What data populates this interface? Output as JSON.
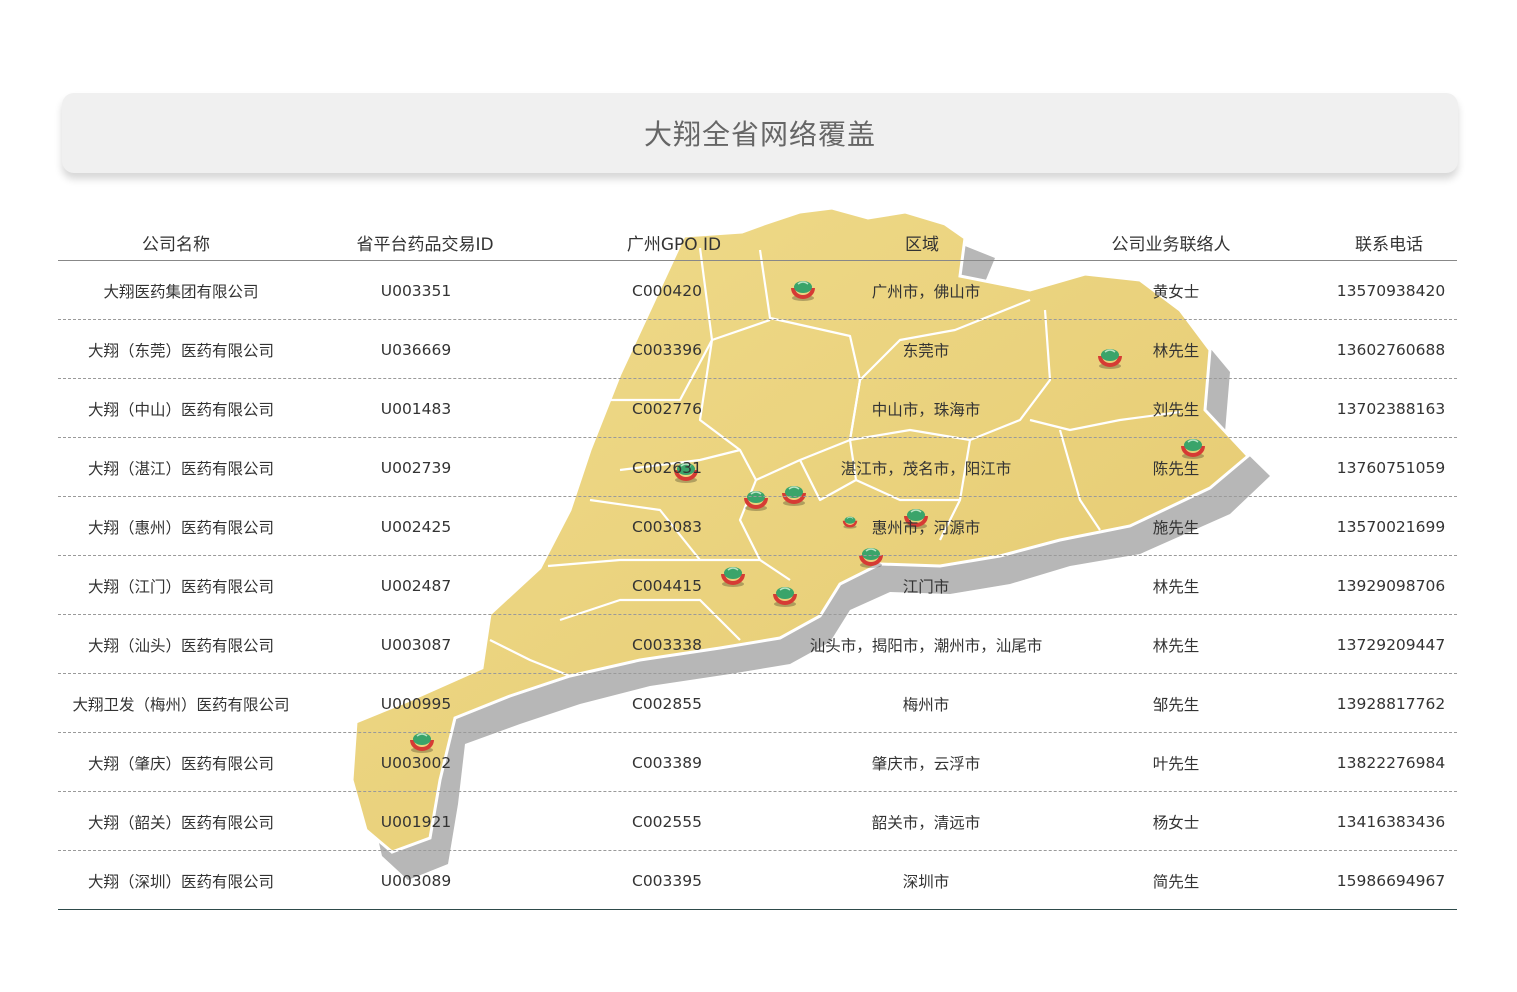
{
  "title": "大翔全省网络覆盖",
  "colors": {
    "map_fill": "#ebd47f",
    "map_border": "#ffffff",
    "map_shadow": "#b8b8b8",
    "marker_red": "#d63b34",
    "marker_green": "#3aa46a"
  },
  "table": {
    "headers": [
      "公司名称",
      "省平台药品交易ID",
      "广州GPO ID",
      "区域",
      "公司业务联络人",
      "联系电话"
    ],
    "rows": [
      [
        "大翔医药集团有限公司",
        "U003351",
        "C000420",
        "广州市，佛山市",
        "黄女士",
        "13570938420"
      ],
      [
        "大翔（东莞）医药有限公司",
        "U036669",
        "C003396",
        "东莞市",
        "林先生",
        "13602760688"
      ],
      [
        "大翔（中山）医药有限公司",
        "U001483",
        "C002776",
        "中山市，珠海市",
        "刘先生",
        "13702388163"
      ],
      [
        "大翔（湛江）医药有限公司",
        "U002739",
        "C002631",
        "湛江市，茂名市，阳江市",
        "陈先生",
        "13760751059"
      ],
      [
        "大翔（惠州）医药有限公司",
        "U002425",
        "C003083",
        "惠州市，河源市",
        "施先生",
        "13570021699"
      ],
      [
        "大翔（江门）医药有限公司",
        "U002487",
        "C004415",
        "江门市",
        "林先生",
        "13929098706"
      ],
      [
        "大翔（汕头）医药有限公司",
        "U003087",
        "C003338",
        "汕头市，揭阳市，潮州市，汕尾市",
        "林先生",
        "13729209447"
      ],
      [
        "大翔卫发（梅州）医药有限公司",
        "U000995",
        "C002855",
        "梅州市",
        "邹先生",
        "13928817762"
      ],
      [
        "大翔（肇庆）医药有限公司",
        "U003002",
        "C003389",
        "肇庆市，云浮市",
        "叶先生",
        "13822276984"
      ],
      [
        "大翔（韶关）医药有限公司",
        "U001921",
        "C002555",
        "韶关市，清远市",
        "杨女士",
        "13416383436"
      ],
      [
        "大翔（深圳）医药有限公司",
        "U003089",
        "C003395",
        "深圳市",
        "简先生",
        "15986694967"
      ]
    ]
  },
  "map": {
    "marker_icon": "company-logo-marker-icon",
    "marker_count": 12
  }
}
